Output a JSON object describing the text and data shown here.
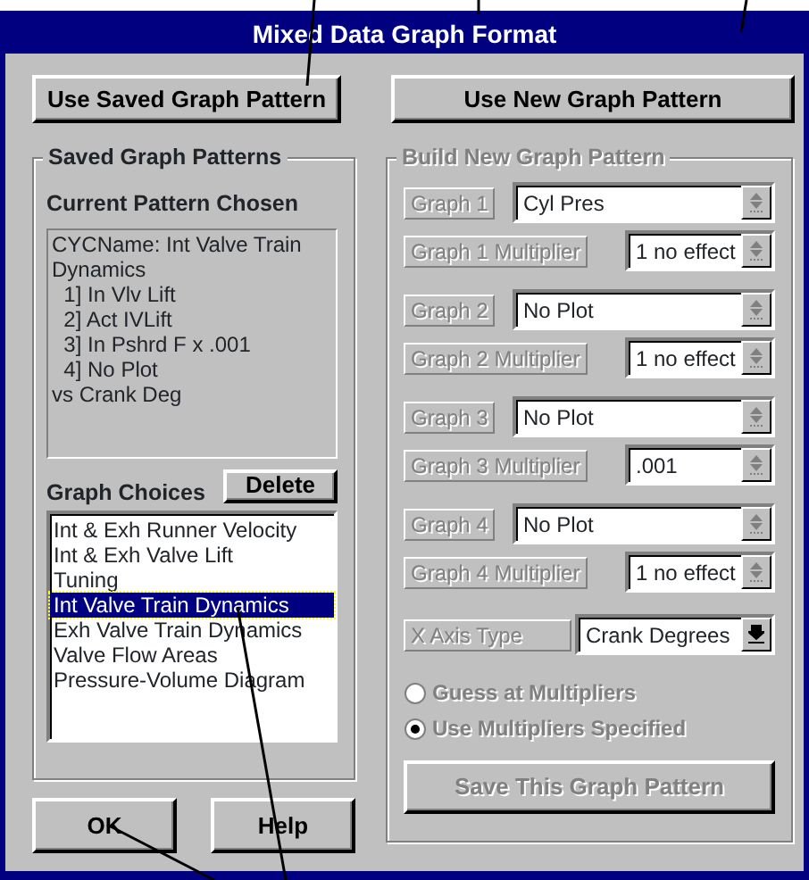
{
  "window": {
    "title": "Mixed Data Graph Format"
  },
  "top_buttons": [
    "Use Saved Graph Pattern",
    "Use New Graph Pattern"
  ],
  "saved": {
    "title": "Saved Graph Patterns",
    "current_heading": "Current Pattern Chosen",
    "current_lines": [
      "CYCName: Int Valve Train Dynamics",
      "  1] In Vlv Lift",
      "  2] Act IVLift",
      "  3] In Pshrd F x .001",
      "  4] No Plot",
      "vs Crank Deg"
    ],
    "choices_heading": "Graph Choices",
    "delete_button": "Delete",
    "choices": [
      {
        "label": "Int & Exh Runner Velocity",
        "selected": false
      },
      {
        "label": "Int & Exh Valve Lift",
        "selected": false
      },
      {
        "label": "Tuning",
        "selected": false
      },
      {
        "label": "Int Valve Train Dynamics",
        "selected": true
      },
      {
        "label": "Exh Valve Train Dynamics",
        "selected": false
      },
      {
        "label": "Valve Flow Areas",
        "selected": false
      },
      {
        "label": "Pressure-Volume Diagram",
        "selected": false
      }
    ]
  },
  "build": {
    "title": "Build New Graph Pattern",
    "disabled": true,
    "graphs": [
      {
        "label": "Graph 1",
        "value": "Cyl Pres",
        "multiplier_label": "Graph 1 Multiplier",
        "multiplier": "1 no effect"
      },
      {
        "label": "Graph 2",
        "value": "No Plot",
        "multiplier_label": "Graph 2 Multiplier",
        "multiplier": "1 no effect"
      },
      {
        "label": "Graph 3",
        "value": "No Plot",
        "multiplier_label": "Graph 3 Multiplier",
        "multiplier": ".001"
      },
      {
        "label": "Graph 4",
        "value": "No Plot",
        "multiplier_label": "Graph 4 Multiplier",
        "multiplier": "1 no effect"
      }
    ],
    "x_axis": {
      "label": "X Axis Type",
      "value": "Crank Degrees",
      "disabled": false
    },
    "radios": [
      {
        "label": "Guess at Multipliers",
        "selected": false
      },
      {
        "label": "Use Multipliers Specified",
        "selected": true
      }
    ],
    "save_button": "Save This Graph Pattern"
  },
  "bottom_buttons": [
    "OK",
    "Help"
  ]
}
